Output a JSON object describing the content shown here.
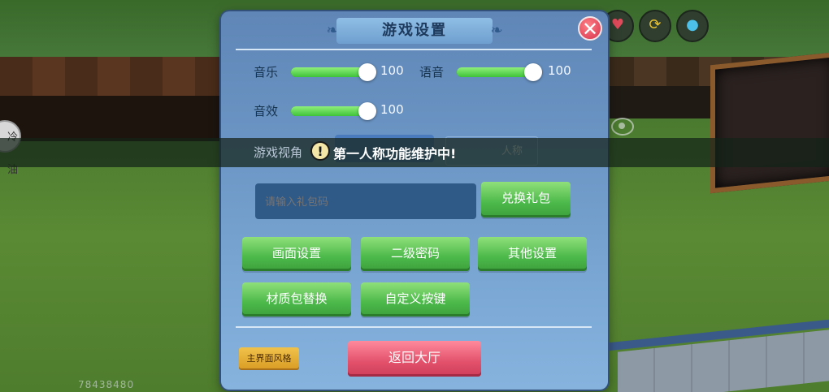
{
  "panel": {
    "title": "游戏设置",
    "audio": [
      {
        "label": "音乐",
        "value": "100",
        "level": 100
      },
      {
        "label": "语音",
        "value": "100",
        "level": 100
      },
      {
        "label": "音效",
        "value": "100",
        "level": 100
      }
    ],
    "view": {
      "label": "游戏视角",
      "option_visible": "人称"
    },
    "gift": {
      "placeholder": "请输入礼包码",
      "redeem_label": "兑换礼包"
    },
    "menu_buttons": [
      "画面设置",
      "二级密码",
      "其他设置",
      "材质包替换",
      "自定义按键"
    ],
    "main_style_label": "主界面风格",
    "return_label": "返回大厅"
  },
  "toast": {
    "message": "第一人称功能维护中!"
  },
  "hud": {
    "left_button_text": "冷\n油",
    "icons": [
      "heart-icon",
      "refresh-icon",
      "water-drop-icon"
    ],
    "uid_text": "78438480"
  },
  "colors": {
    "accent_green": "#4bb84a",
    "accent_red": "#e2506a",
    "panel_blue": "#6b95c4"
  }
}
